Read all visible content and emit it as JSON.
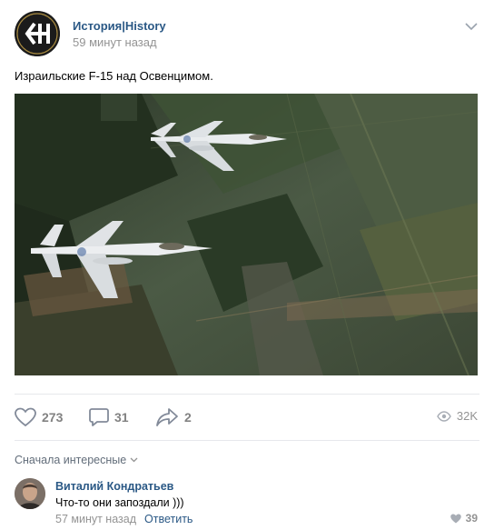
{
  "post": {
    "group_name": "История|History",
    "time": "59 минут назад",
    "text": "Израильские F-15 над Освенцимом."
  },
  "actions": {
    "likes": "273",
    "comments": "31",
    "shares": "2",
    "views": "32K"
  },
  "comments_section": {
    "sort_label": "Сначала интересные",
    "items": [
      {
        "author": "Виталий Кондратьев",
        "text": "Что-то они запоздали )))",
        "time": "57 минут назад",
        "reply_label": "Ответить",
        "likes": "39"
      }
    ]
  },
  "colors": {
    "link": "#2a5885",
    "muted": "#939393",
    "icon": "#828a99"
  },
  "icons": {
    "group_avatar": "EH-logo",
    "menu": "chevron-down-icon",
    "like": "heart-icon",
    "comment": "comment-bubble-icon",
    "share": "share-arrow-icon",
    "views": "eye-icon"
  }
}
